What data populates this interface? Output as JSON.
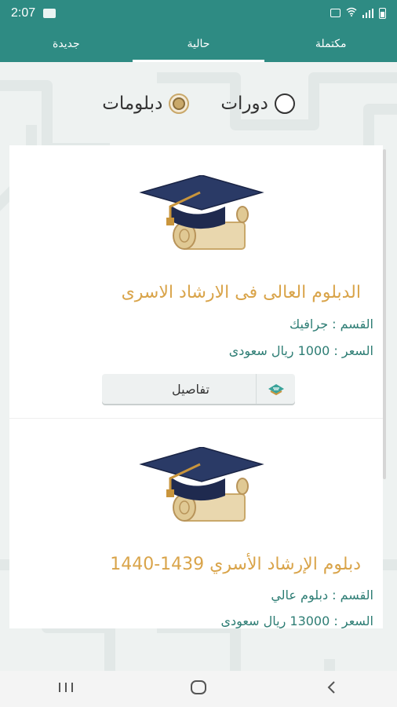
{
  "status_bar": {
    "time": "2:07"
  },
  "tabs": [
    {
      "label": "مكتملة",
      "active": false
    },
    {
      "label": "حالية",
      "active": true
    },
    {
      "label": "جديدة",
      "active": false
    }
  ],
  "filter": {
    "options": [
      {
        "label": "دورات",
        "selected": false
      },
      {
        "label": "دبلومات",
        "selected": true
      }
    ]
  },
  "cards": [
    {
      "title": "الدبلوم العالى فى الارشاد الاسرى",
      "department": "القسم : جرافيك",
      "price": "السعر : 1000 ريال سعودى",
      "details_label": "تفاصيل"
    },
    {
      "title": "دبلوم الإرشاد الأسري 1439-1440",
      "department": "القسم : دبلوم عالي",
      "price": "السعر : 13000 ريال سعودى"
    }
  ],
  "colors": {
    "primary": "#2e8b83",
    "title_gold": "#d9a44a",
    "meta_teal": "#2d7d74"
  },
  "icons": [
    "graduation-cap-icon",
    "details-icon",
    "recent-apps-icon",
    "home-icon",
    "back-icon"
  ]
}
